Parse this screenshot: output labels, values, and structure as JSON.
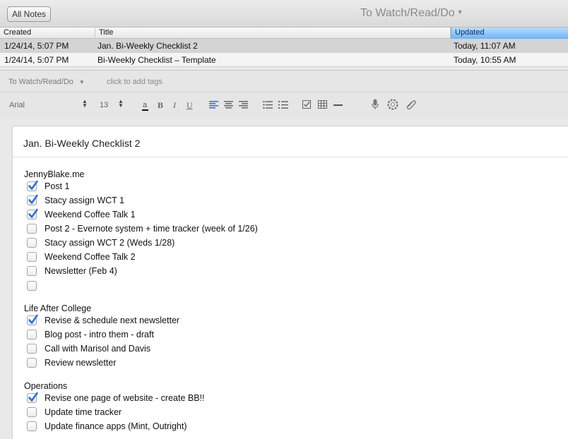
{
  "topbar": {
    "all_notes_label": "All Notes",
    "notebook_title": "To Watch/Read/Do"
  },
  "list": {
    "headers": {
      "created": "Created",
      "title": "Title",
      "updated": "Updated"
    },
    "rows": [
      {
        "created": "1/24/14, 5:07 PM",
        "title": "Jan. Bi-Weekly Checklist 2",
        "updated": "Today, 11:07 AM"
      },
      {
        "created": "1/24/14, 5:07 PM",
        "title": "Bi-Weekly Checklist – Template",
        "updated": "Today, 10:55 AM"
      }
    ]
  },
  "tagbar": {
    "notebook": "To Watch/Read/Do",
    "add_tags_placeholder": "click to add tags"
  },
  "toolbar": {
    "font": "Arial",
    "size": "13"
  },
  "note": {
    "title": "Jan. Bi-Weekly Checklist 2",
    "sections": [
      {
        "heading": "JennyBlake.me",
        "items": [
          {
            "text": "Post 1",
            "checked": true
          },
          {
            "text": "Stacy assign WCT 1",
            "checked": true
          },
          {
            "text": "Weekend Coffee Talk 1",
            "checked": true
          },
          {
            "text": "Post 2 - Evernote system + time tracker (week of 1/26)",
            "checked": false
          },
          {
            "text": "Stacy assign WCT 2 (Weds 1/28)",
            "checked": false
          },
          {
            "text": "Weekend Coffee Talk 2",
            "checked": false
          },
          {
            "text": "Newsletter (Feb 4)",
            "checked": false
          },
          {
            "text": "",
            "checked": false
          }
        ]
      },
      {
        "heading": "Life After College",
        "items": [
          {
            "text": "Revise & schedule next newsletter",
            "checked": true
          },
          {
            "text": "Blog post - intro them - draft",
            "checked": false
          },
          {
            "text": "Call with Marisol and Davis",
            "checked": false
          },
          {
            "text": "Review newsletter",
            "checked": false
          }
        ]
      },
      {
        "heading": "Operations",
        "items": [
          {
            "text": "Revise one page of website - create BB!!",
            "checked": true
          },
          {
            "text": "Update time tracker",
            "checked": false
          },
          {
            "text": "Update finance apps (Mint, Outright)",
            "checked": false
          }
        ]
      }
    ]
  },
  "colors": {
    "accent": "#2f6fd6",
    "header_selected": "#6fb3f4"
  },
  "icons": [
    "underline-a-icon",
    "bold-icon",
    "italic-icon",
    "underline-icon",
    "align-left-icon",
    "align-center-icon",
    "align-right-icon",
    "bullet-list-icon",
    "numbered-list-icon",
    "checkbox-icon",
    "table-icon",
    "horizontal-rule-icon",
    "microphone-icon",
    "camera-icon",
    "paperclip-icon"
  ]
}
